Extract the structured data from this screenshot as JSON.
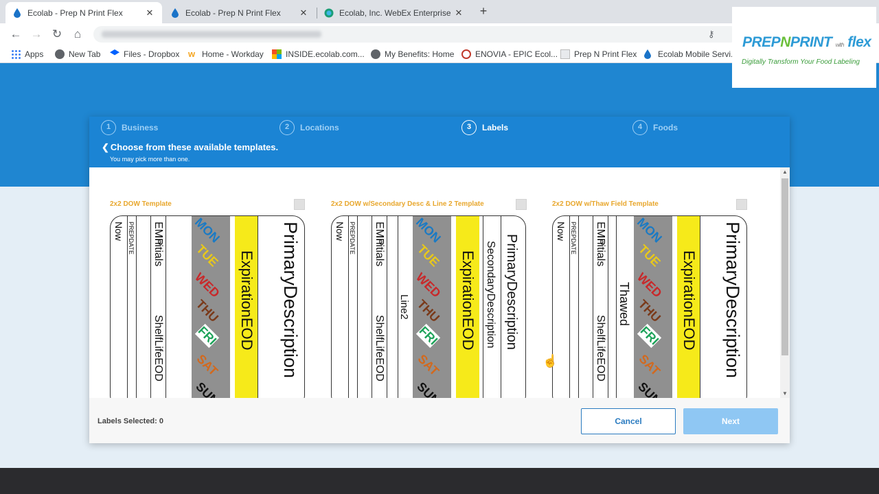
{
  "browser": {
    "tabs": [
      {
        "title": "Ecolab - Prep N Print Flex",
        "active": true
      },
      {
        "title": "Ecolab - Prep N Print Flex",
        "active": false
      },
      {
        "title": "Ecolab, Inc. WebEx Enterprise Site",
        "active": false
      }
    ],
    "bookmarks": [
      "Apps",
      "New Tab",
      "Files - Dropbox",
      "Home - Workday",
      "INSIDE.ecolab.com...",
      "My Benefits: Home",
      "ENOVIA - EPIC Ecol...",
      "Prep N Print Flex",
      "Ecolab Mobile Servi..."
    ]
  },
  "logo": {
    "prep": "PREP",
    "n": "N",
    "print": "PRINT",
    "with": "with",
    "flex": "flex",
    "tagline": "Digitally Transform Your Food Labeling"
  },
  "wizard": {
    "steps": [
      {
        "num": "1",
        "label": "Business"
      },
      {
        "num": "2",
        "label": "Locations"
      },
      {
        "num": "3",
        "label": "Labels"
      },
      {
        "num": "4",
        "label": "Foods"
      }
    ],
    "active_step": 3,
    "title": "Choose from these available templates.",
    "subtitle": "You may pick more than one.",
    "templates": [
      {
        "title": "2x2 DOW Template"
      },
      {
        "title": "2x2 DOW w/Secondary Desc & Line 2 Template"
      },
      {
        "title": "2x2 DOW w/Thaw Field Template"
      }
    ],
    "label_text": {
      "now": "Now",
      "prepdate": "PREPDATE",
      "emp": "EMP",
      "initials": "Initials",
      "shelflife": "ShelfLifeEOD",
      "expiration": "ExpirationEOD",
      "primary": "PrimaryDescription",
      "secondary": "SecondaryDescription",
      "line2": "Line2",
      "thawed": "Thawed",
      "days": [
        "MON",
        "TUE",
        "WED",
        "THU",
        "FRI",
        "SAT",
        "SUN"
      ]
    },
    "labels_selected": "Labels Selected: 0",
    "cancel": "Cancel",
    "next": "Next"
  },
  "colors": {
    "blue_band": "#1f86d1",
    "template_title": "#e8a72d",
    "expiration_yellow": "#f6ea1a",
    "next_disabled": "#8fc7f3"
  }
}
